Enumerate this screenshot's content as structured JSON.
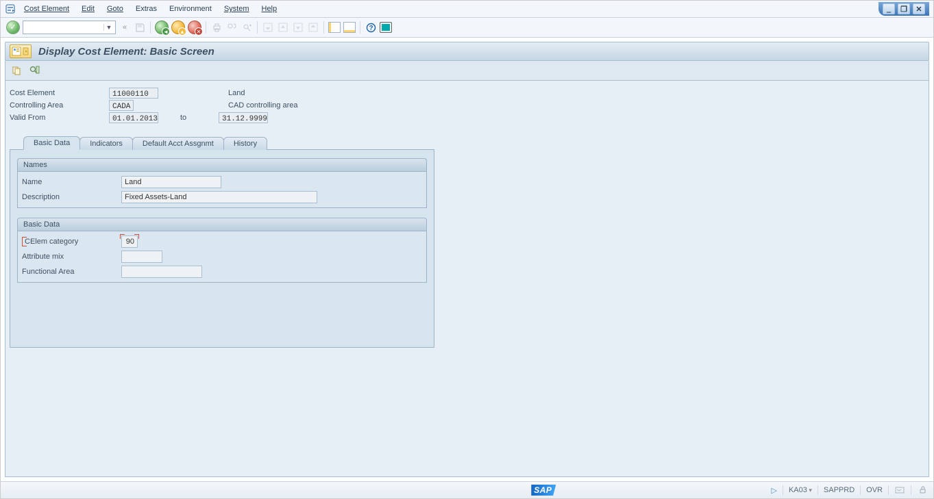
{
  "menubar": {
    "items": [
      {
        "label": "Cost Element",
        "ul_index": 0
      },
      {
        "label": "Edit",
        "ul_index": 0
      },
      {
        "label": "Goto",
        "ul_index": 0
      },
      {
        "label": "Extras",
        "ul_index": 1
      },
      {
        "label": "Environment",
        "ul_index": 2
      },
      {
        "label": "System",
        "ul_index": 0
      },
      {
        "label": "Help",
        "ul_index": 0
      }
    ]
  },
  "title": "Display Cost Element: Basic Screen",
  "header": {
    "cost_element_label": "Cost Element",
    "cost_element_value": "11000110",
    "cost_element_text": "Land",
    "controlling_area_label": "Controlling Area",
    "controlling_area_value": "CADA",
    "controlling_area_text": "CAD controlling area",
    "valid_from_label": "Valid From",
    "valid_from_value": "01.01.2013",
    "to_label": "to",
    "valid_to_value": "31.12.9999"
  },
  "tabs": [
    "Basic Data",
    "Indicators",
    "Default Acct Assgnmt",
    "History"
  ],
  "active_tab_index": 0,
  "group_names": {
    "title": "Names",
    "name_label": "Name",
    "name_value": "Land",
    "desc_label": "Description",
    "desc_value": "Fixed Assets-Land"
  },
  "group_basic": {
    "title": "Basic Data",
    "category_label": "CElem category",
    "category_value": "90",
    "attrmix_label": "Attribute mix",
    "attrmix_value": "",
    "funcarea_label": "Functional Area",
    "funcarea_value": ""
  },
  "statusbar": {
    "logo": "SAP",
    "tcode": "KA03",
    "system": "SAPPRD",
    "mode": "OVR"
  }
}
